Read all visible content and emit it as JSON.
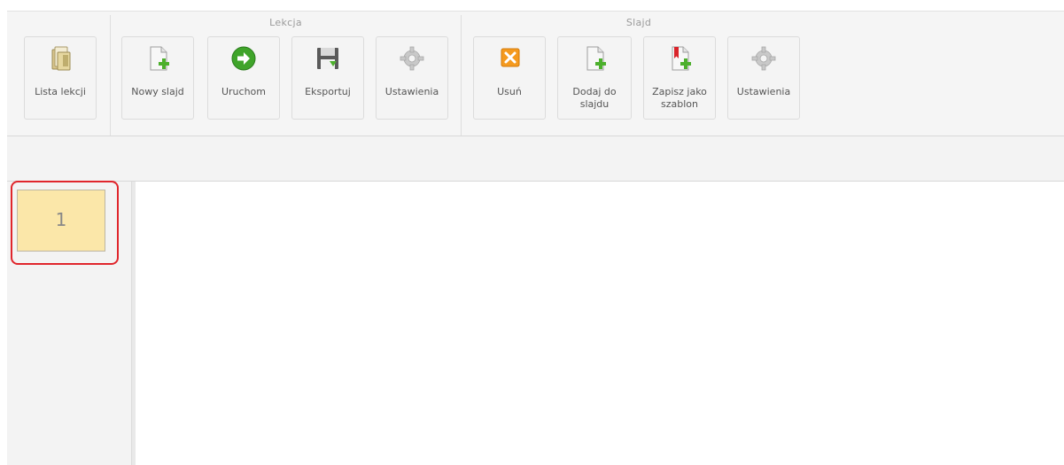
{
  "toolbar": {
    "lesson_list": {
      "label": "Lista lekcji",
      "icon": "folder-icon"
    },
    "groups": {
      "lesson": {
        "title": "Lekcja",
        "new_slide": {
          "label": "Nowy slajd",
          "icon": "page-add-icon"
        },
        "run": {
          "label": "Uruchom",
          "icon": "arrow-right-circle-icon"
        },
        "export": {
          "label": "Eksportuj",
          "icon": "floppy-disk-icon"
        },
        "settings": {
          "label": "Ustawienia",
          "icon": "gear-icon"
        }
      },
      "slide": {
        "title": "Slajd",
        "delete": {
          "label": "Usuń",
          "icon": "delete-x-icon"
        },
        "add_to_slide": {
          "label": "Dodaj do\nslajdu",
          "icon": "page-add-icon"
        },
        "save_template": {
          "label": "Zapisz jako\nszablon",
          "icon": "bookmark-page-add-icon"
        },
        "settings": {
          "label": "Ustawienia",
          "icon": "gear-icon"
        }
      }
    }
  },
  "slides": [
    {
      "number": "1"
    }
  ],
  "colors": {
    "selection_outline": "#e0262c",
    "slide_thumb_bg": "#fbe7a9",
    "accent_green": "#4caf2c",
    "delete_orange": "#f59a1f"
  }
}
